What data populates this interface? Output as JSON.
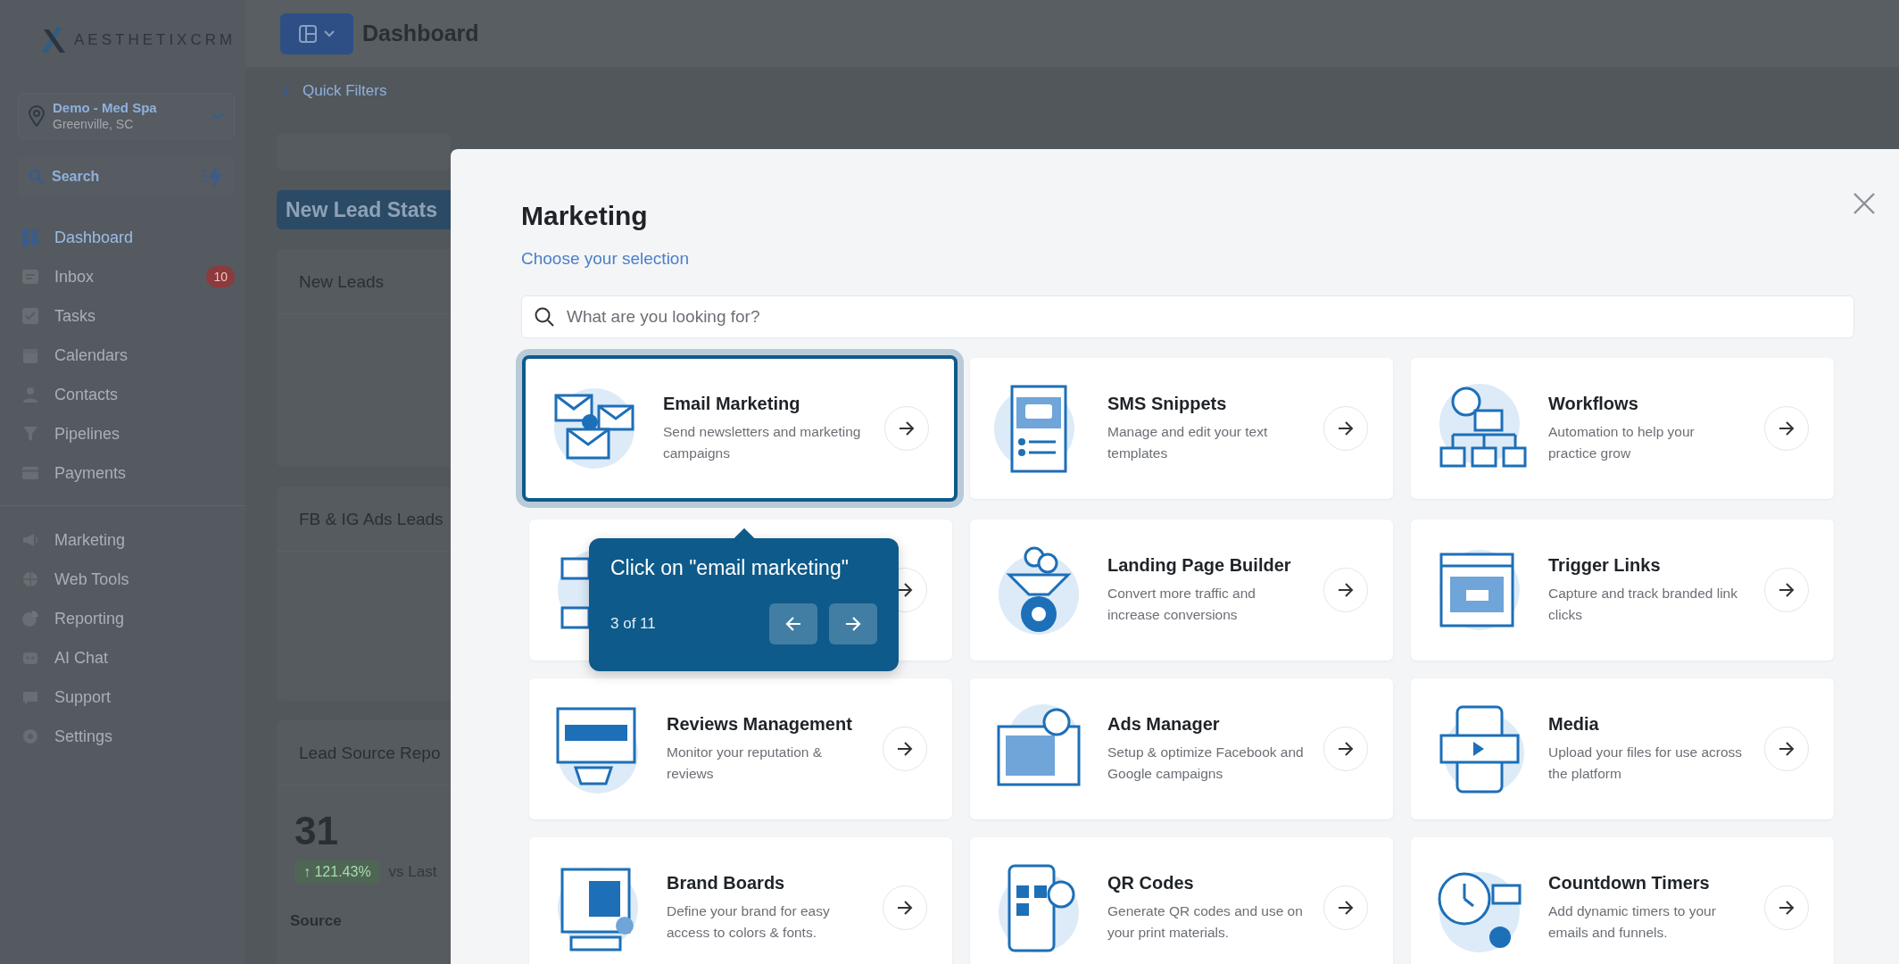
{
  "sidebar": {
    "logo": "AESTHETIXCRM",
    "location": {
      "name": "Demo - Med Spa",
      "place": "Greenville, SC"
    },
    "search": {
      "placeholder": "Search"
    },
    "items": [
      {
        "label": "Dashboard",
        "selected": true
      },
      {
        "label": "Inbox",
        "selected": false,
        "badge": "10"
      },
      {
        "label": "Tasks",
        "selected": false
      },
      {
        "label": "Calendars",
        "selected": false
      },
      {
        "label": "Contacts",
        "selected": false
      },
      {
        "label": "Pipelines",
        "selected": false
      },
      {
        "label": "Payments",
        "selected": false
      },
      {
        "label": "Marketing",
        "selected": false,
        "group_start": true
      },
      {
        "label": "Web Tools",
        "selected": false
      },
      {
        "label": "Reporting",
        "selected": false
      },
      {
        "label": "AI Chat",
        "selected": false
      },
      {
        "label": "Support",
        "selected": false
      },
      {
        "label": "Settings",
        "selected": false
      }
    ]
  },
  "header": {
    "title": "Dashboard",
    "quick_filters": "Quick Filters"
  },
  "dashboard": {
    "section_button": "New Lead Stats",
    "widgets": [
      {
        "title": "New Leads"
      },
      {
        "title": "FB & IG Ads Leads"
      },
      {
        "title": "Lead Source Repo",
        "value": "31",
        "change": "↑ 121.43%",
        "comparison": "vs Last",
        "column": "Source"
      }
    ]
  },
  "modal": {
    "title": "Marketing",
    "subtitle": "Choose your selection",
    "search": {
      "placeholder": "What are you looking for?"
    },
    "cards": [
      {
        "title": "Email Marketing",
        "description": "Send newsletters and marketing campaigns",
        "highlighted": true
      },
      {
        "title": "SMS Snippets",
        "description": "Manage and edit your text templates",
        "highlighted": false
      },
      {
        "title": "Workflows",
        "description": "Automation to help your practice grow",
        "highlighted": false
      },
      {
        "highlighted": false
      },
      {
        "title": "Landing Page Builder",
        "description": "Convert more traffic and increase conversions",
        "highlighted": false
      },
      {
        "title": "Trigger Links",
        "description": "Capture and track branded link clicks",
        "highlighted": false
      },
      {
        "title": "Reviews Management",
        "description": "Monitor your reputation & reviews",
        "highlighted": false
      },
      {
        "title": "Ads Manager",
        "description": "Setup & optimize Facebook and Google campaigns",
        "highlighted": false
      },
      {
        "title": "Media",
        "description": "Upload your files for use across the platform",
        "highlighted": false
      },
      {
        "title": "Brand Boards",
        "description": "Define your brand for easy access to colors & fonts.",
        "highlighted": false
      },
      {
        "title": "QR Codes",
        "description": "Generate QR codes and use on your print materials.",
        "highlighted": false
      },
      {
        "title": "Countdown Timers",
        "description": "Add dynamic timers to your emails and funnels.",
        "highlighted": false
      }
    ]
  },
  "tour": {
    "text": "Click on \"email marketing\"",
    "step": "3 of 11"
  }
}
